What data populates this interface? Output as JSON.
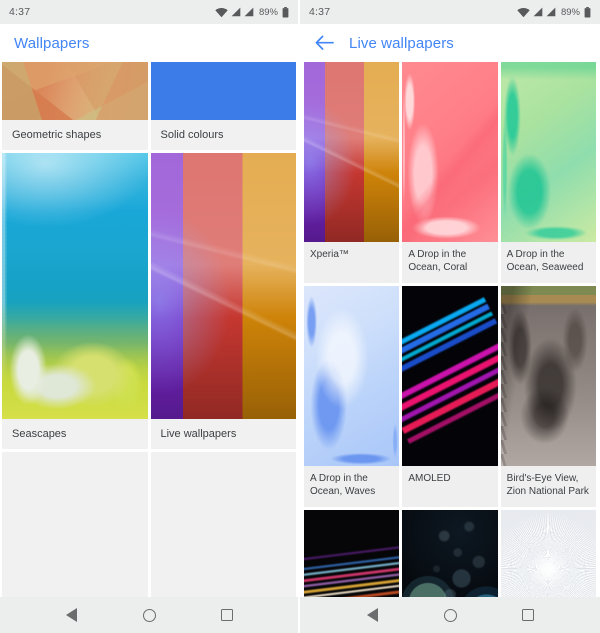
{
  "colors": {
    "accent_blue": "#4285f4",
    "statusbar_bg": "#eceded",
    "navbar_bg": "#eceded",
    "label_text": "#3c4043",
    "placeholder_tile": "#f1f1f1"
  },
  "status_bar": {
    "time": "4:37",
    "battery_percent": "89%",
    "icons": [
      "wifi-icon",
      "signal-icon",
      "signal-icon",
      "battery-icon"
    ]
  },
  "left_screen": {
    "title": "Wallpapers",
    "categories": [
      {
        "label": "Geometric shapes",
        "art": "art-geo",
        "size": "small"
      },
      {
        "label": "Solid colours",
        "art": "art-solid",
        "size": "small"
      },
      {
        "label": "Seascapes",
        "art": "art-sea",
        "size": "tall"
      },
      {
        "label": "Live wallpapers",
        "art": "art-xperia",
        "size": "tall"
      }
    ]
  },
  "right_screen": {
    "title": "Live wallpapers",
    "back_icon": "back-arrow-icon",
    "wallpapers": [
      {
        "label": "Xperia™",
        "art": "art-xperia",
        "row": 1
      },
      {
        "label": "A Drop in the Ocean, Coral",
        "art": "art-coral",
        "row": 1
      },
      {
        "label": "A Drop in the Ocean, Seaweed",
        "art": "art-seaweed",
        "row": 1
      },
      {
        "label": "A Drop in the Ocean, Waves",
        "art": "art-waves",
        "row": 2
      },
      {
        "label": "AMOLED",
        "art": "art-amoled",
        "row": 2
      },
      {
        "label": "Bird's-Eye View, Zion National Park",
        "art": "art-zion",
        "row": 2
      },
      {
        "label": "",
        "art": "art-rainbow",
        "row": 3
      },
      {
        "label": "",
        "art": "art-bubbles",
        "row": 3
      },
      {
        "label": "",
        "art": "art-burst",
        "row": 3
      }
    ]
  },
  "nav_bar": {
    "buttons": [
      {
        "name": "back-nav-button",
        "icon": "triangle-back-icon"
      },
      {
        "name": "home-nav-button",
        "icon": "circle-home-icon"
      },
      {
        "name": "recents-nav-button",
        "icon": "square-recents-icon"
      }
    ]
  }
}
